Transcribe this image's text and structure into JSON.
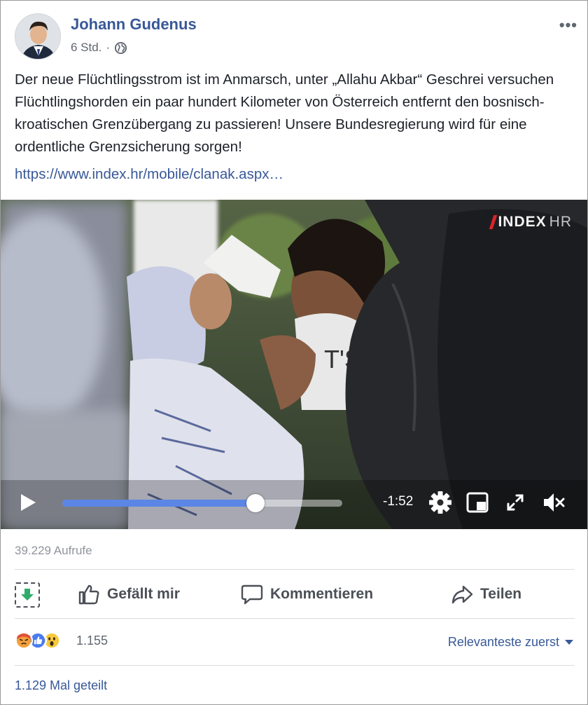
{
  "post": {
    "author": "Johann Gudenus",
    "timestamp": "6 Std.",
    "separator": "·",
    "privacy_icon": "globe-icon",
    "more_label": "•••",
    "text": "Der neue Flüchtlingsstrom ist im Anmarsch, unter „Allahu Akbar“ Geschrei versuchen Flüchtlingshorden ein paar hundert Kilometer von Österreich entfernt den bosnisch-kroatischen Grenzübergang zu passieren! Unsere Bundesregierung wird für eine ordentliche Grenzsicherung sorgen!",
    "link": "https://www.index.hr/mobile/clanak.aspx…"
  },
  "video": {
    "logo_main": "INDEX",
    "logo_suffix": "HR",
    "progress": 0.69,
    "time_remaining": "-1:52",
    "icons": [
      "play-icon",
      "settings-icon",
      "mini-player-icon",
      "fullscreen-icon",
      "mute-icon"
    ]
  },
  "stats": {
    "views": "39.229 Aufrufe",
    "reaction_count": "1.155",
    "reactions": [
      "angry",
      "like",
      "wow"
    ],
    "shares": "1.129 Mal geteilt",
    "sort_label": "Relevanteste zuerst"
  },
  "actions": {
    "like": "Gefällt mir",
    "comment": "Kommentieren",
    "share": "Teilen"
  },
  "colors": {
    "link": "#385898",
    "progress": "#5b86e5",
    "text": "#1d2129",
    "muted": "#90949c"
  }
}
